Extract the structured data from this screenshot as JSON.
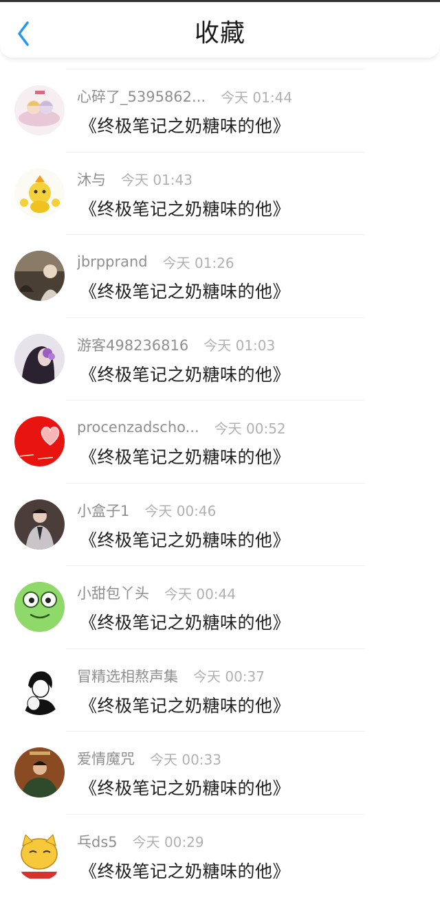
{
  "header": {
    "title": "收藏"
  },
  "items": [
    {
      "name": "心碎了_5395862...",
      "time": "今天 01:44",
      "story": "《终极笔记之奶糖味的他》"
    },
    {
      "name": "沐与",
      "time": "今天 01:43",
      "story": "《终极笔记之奶糖味的他》"
    },
    {
      "name": "jbrpprand",
      "time": "今天 01:26",
      "story": "《终极笔记之奶糖味的他》"
    },
    {
      "name": "游客498236816",
      "time": "今天 01:03",
      "story": "《终极笔记之奶糖味的他》"
    },
    {
      "name": "procenzadscho...",
      "time": "今天 00:52",
      "story": "《终极笔记之奶糖味的他》"
    },
    {
      "name": "小盒子1",
      "time": "今天 00:46",
      "story": "《终极笔记之奶糖味的他》"
    },
    {
      "name": "小甜包丫头",
      "time": "今天 00:44",
      "story": "《终极笔记之奶糖味的他》"
    },
    {
      "name": "冒精选相熬声集",
      "time": "今天 00:37",
      "story": "《终极笔记之奶糖味的他》"
    },
    {
      "name": "爱情魔咒",
      "time": "今天 00:33",
      "story": "《终极笔记之奶糖味的他》"
    },
    {
      "name": "乓ds5",
      "time": "今天 00:29",
      "story": "《终极笔记之奶糖味的他》"
    }
  ],
  "colors": {
    "accent": "#2196F3",
    "name_text": "#8e8e8e",
    "time_text": "#b0b0b0"
  }
}
